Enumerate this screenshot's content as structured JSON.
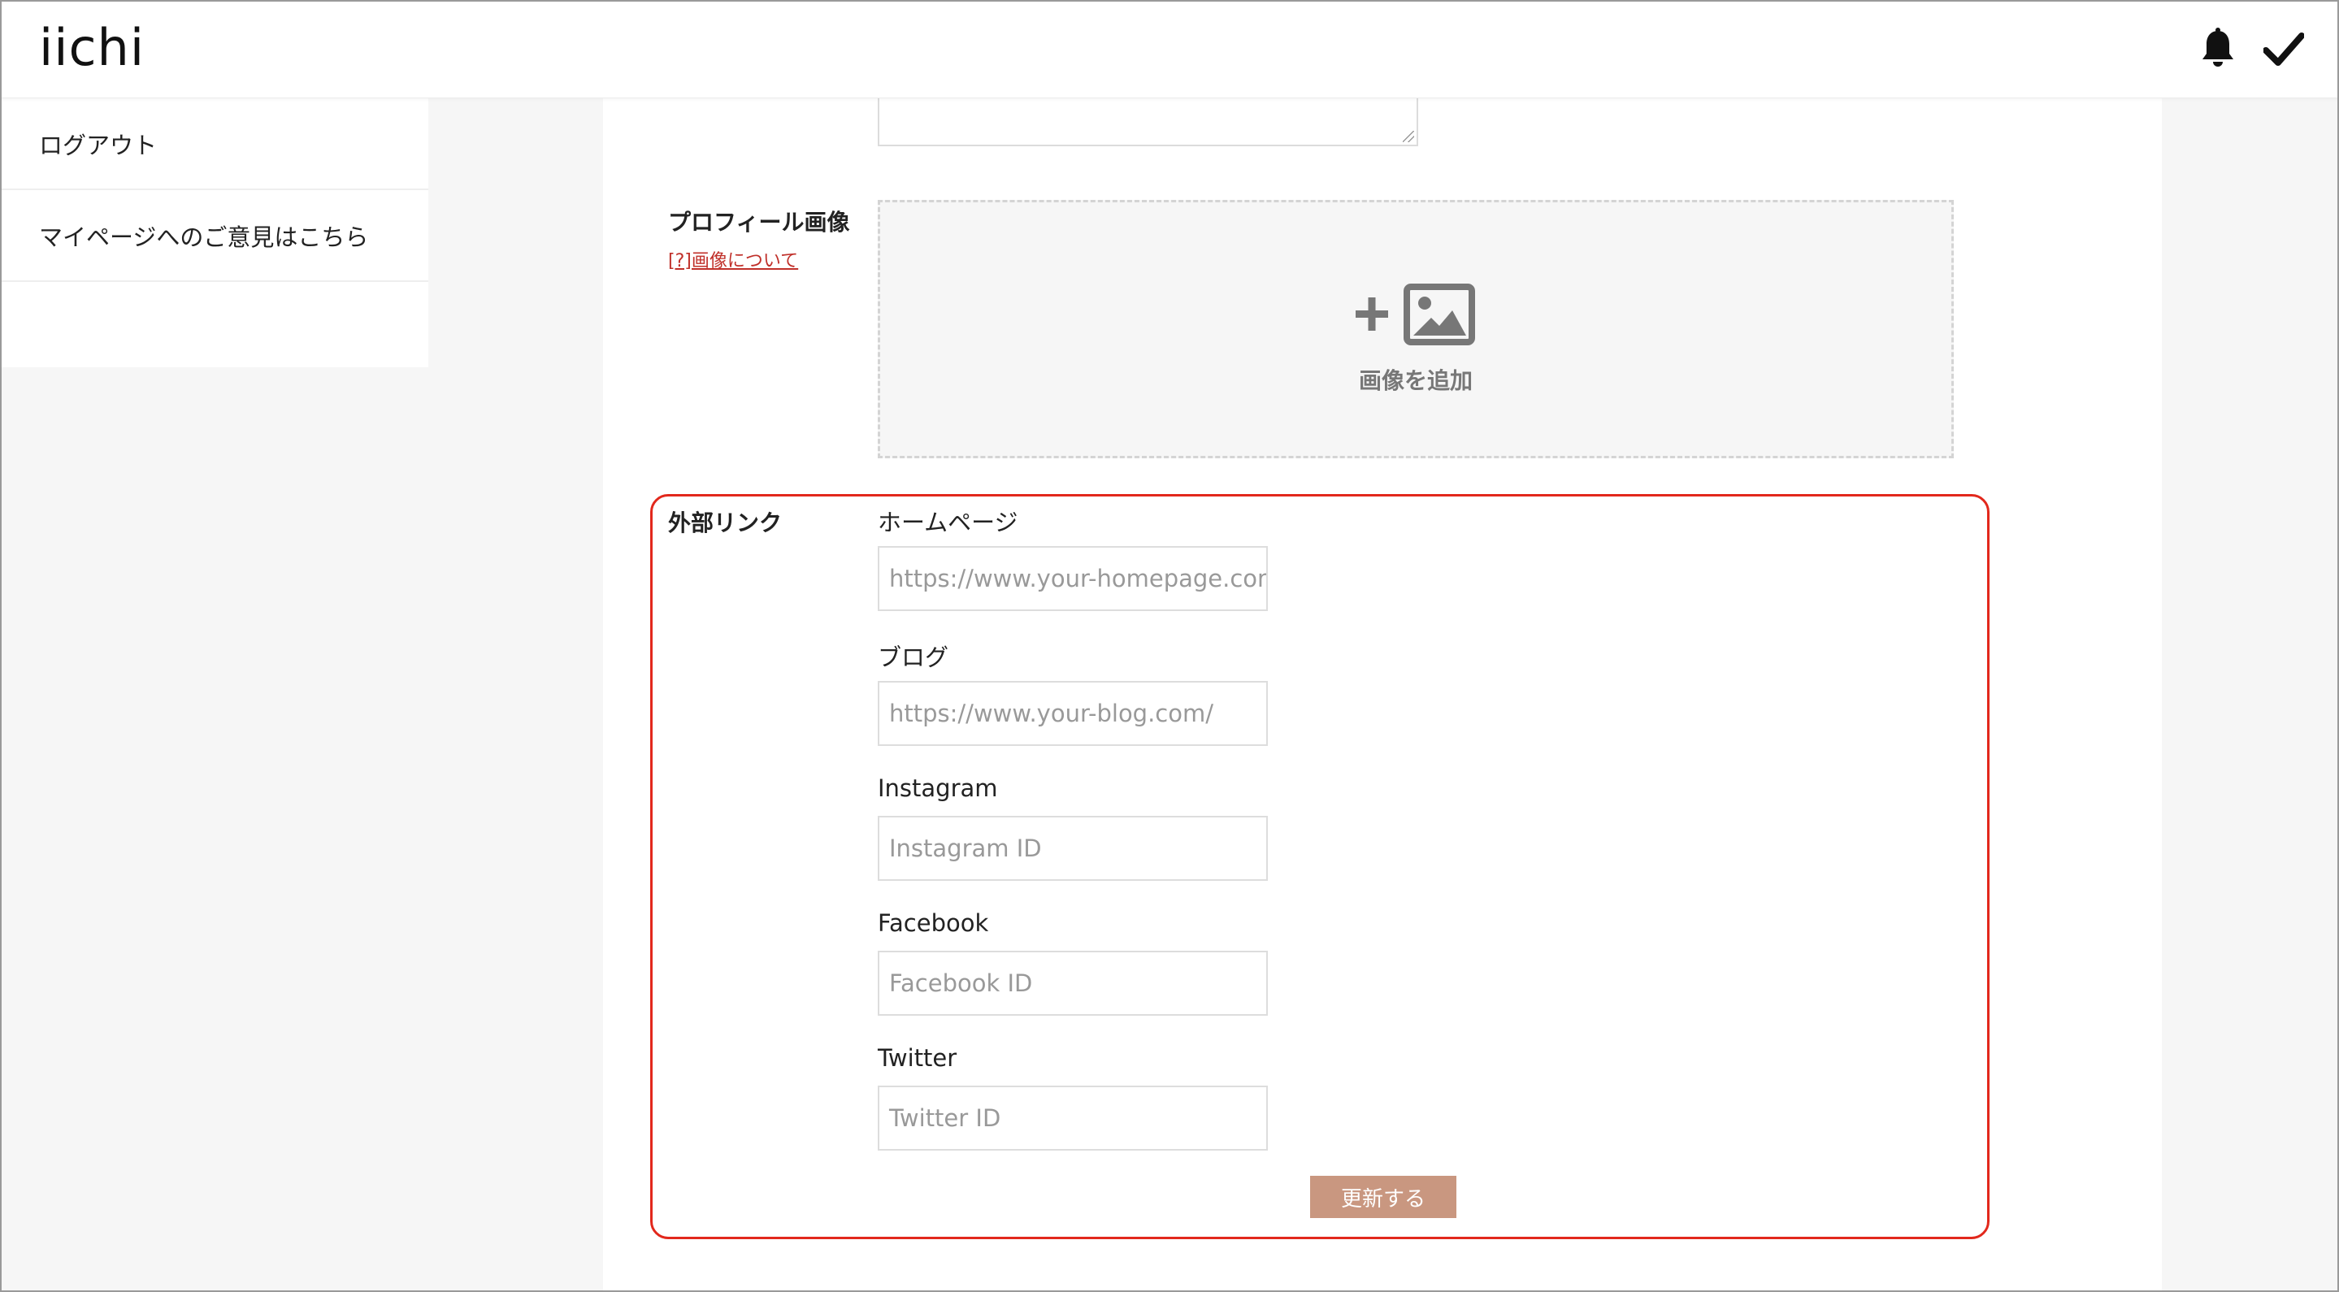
{
  "header": {
    "logo": "iichi",
    "icons": [
      "bell-icon",
      "check-icon"
    ]
  },
  "sidebar": {
    "items": [
      {
        "label": "ログアウト"
      },
      {
        "label": "マイページへのご意見はこちら"
      },
      {
        "label": ""
      }
    ]
  },
  "profile_image": {
    "label": "プロフィール画像",
    "help_link": "[?]画像について",
    "add_label": "画像を追加",
    "icon": "add-image-icon"
  },
  "external_links": {
    "label": "外部リンク",
    "fields": [
      {
        "label": "ホームページ",
        "placeholder": "https://www.your-homepage.com"
      },
      {
        "label": "ブログ",
        "placeholder": "https://www.your-blog.com/"
      },
      {
        "label": "Instagram",
        "placeholder": "Instagram ID"
      },
      {
        "label": "Facebook",
        "placeholder": "Facebook ID"
      },
      {
        "label": "Twitter",
        "placeholder": "Twitter ID"
      }
    ],
    "submit_label": "更新する"
  },
  "colors": {
    "accent_button": "#c99780",
    "highlight_border": "#e2281c",
    "help_link": "#c0302a"
  }
}
